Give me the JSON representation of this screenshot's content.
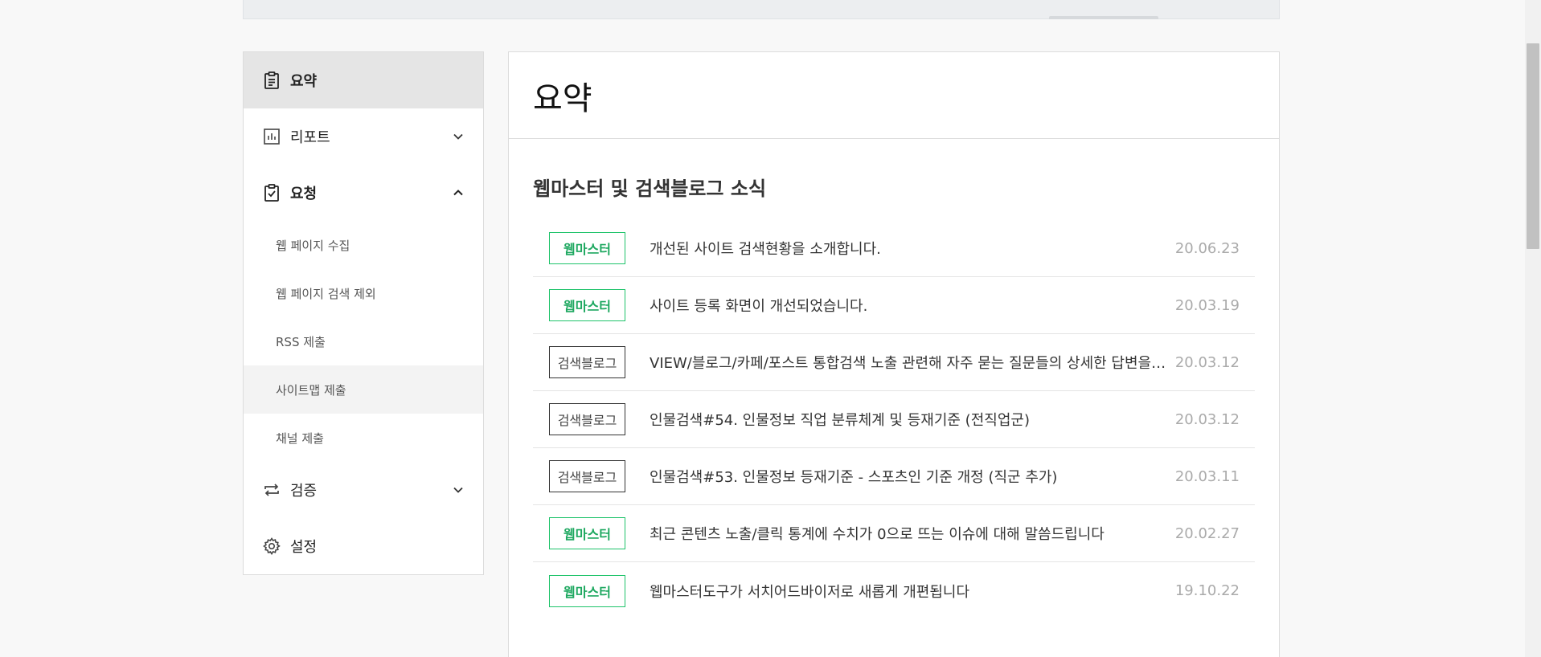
{
  "sidebar": {
    "summary": {
      "label": "요약",
      "icon": "clipboard-icon"
    },
    "report": {
      "label": "리포트",
      "icon": "bar-chart-icon"
    },
    "request": {
      "label": "요청",
      "icon": "clipboard-check-icon",
      "sub_items": [
        "웹 페이지 수집",
        "웹 페이지 검색 제외",
        "RSS 제출",
        "사이트맵 제출",
        "채널 제출"
      ]
    },
    "verify": {
      "label": "검증",
      "icon": "repeat-arrows-icon"
    },
    "settings": {
      "label": "설정",
      "icon": "gear-icon"
    }
  },
  "main": {
    "title": "요약",
    "section_title": "웹마스터 및 검색블로그 소식",
    "news": [
      {
        "badge": "웹마스터",
        "type": "webmaster",
        "title": "개선된 사이트 검색현황을 소개합니다.",
        "date": "20.06.23"
      },
      {
        "badge": "웹마스터",
        "type": "webmaster",
        "title": "사이트 등록 화면이 개선되었습니다.",
        "date": "20.03.19"
      },
      {
        "badge": "검색블로그",
        "type": "search-blog",
        "title": "VIEW/블로그/카페/포스트 통합검색 노출 관련해 자주 묻는 질문들의 상세한 답변을 공유합니다",
        "date": "20.03.12"
      },
      {
        "badge": "검색블로그",
        "type": "search-blog",
        "title": "인물검색#54. 인물정보 직업 분류체계 및 등재기준 (전직업군)",
        "date": "20.03.12"
      },
      {
        "badge": "검색블로그",
        "type": "search-blog",
        "title": "인물검색#53. 인물정보 등재기준 - 스포츠인 기준 개정 (직군 추가)",
        "date": "20.03.11"
      },
      {
        "badge": "웹마스터",
        "type": "webmaster",
        "title": "최근 콘텐츠 노출/클릭 통계에 수치가 0으로 뜨는 이슈에 대해 말씀드립니다",
        "date": "20.02.27"
      },
      {
        "badge": "웹마스터",
        "type": "webmaster",
        "title": "웹마스터도구가 서치어드바이저로 새롭게 개편됩니다",
        "date": "19.10.22"
      }
    ]
  },
  "colors": {
    "accent_green": "#1ec36a",
    "active_bg": "#e5e5e5"
  }
}
